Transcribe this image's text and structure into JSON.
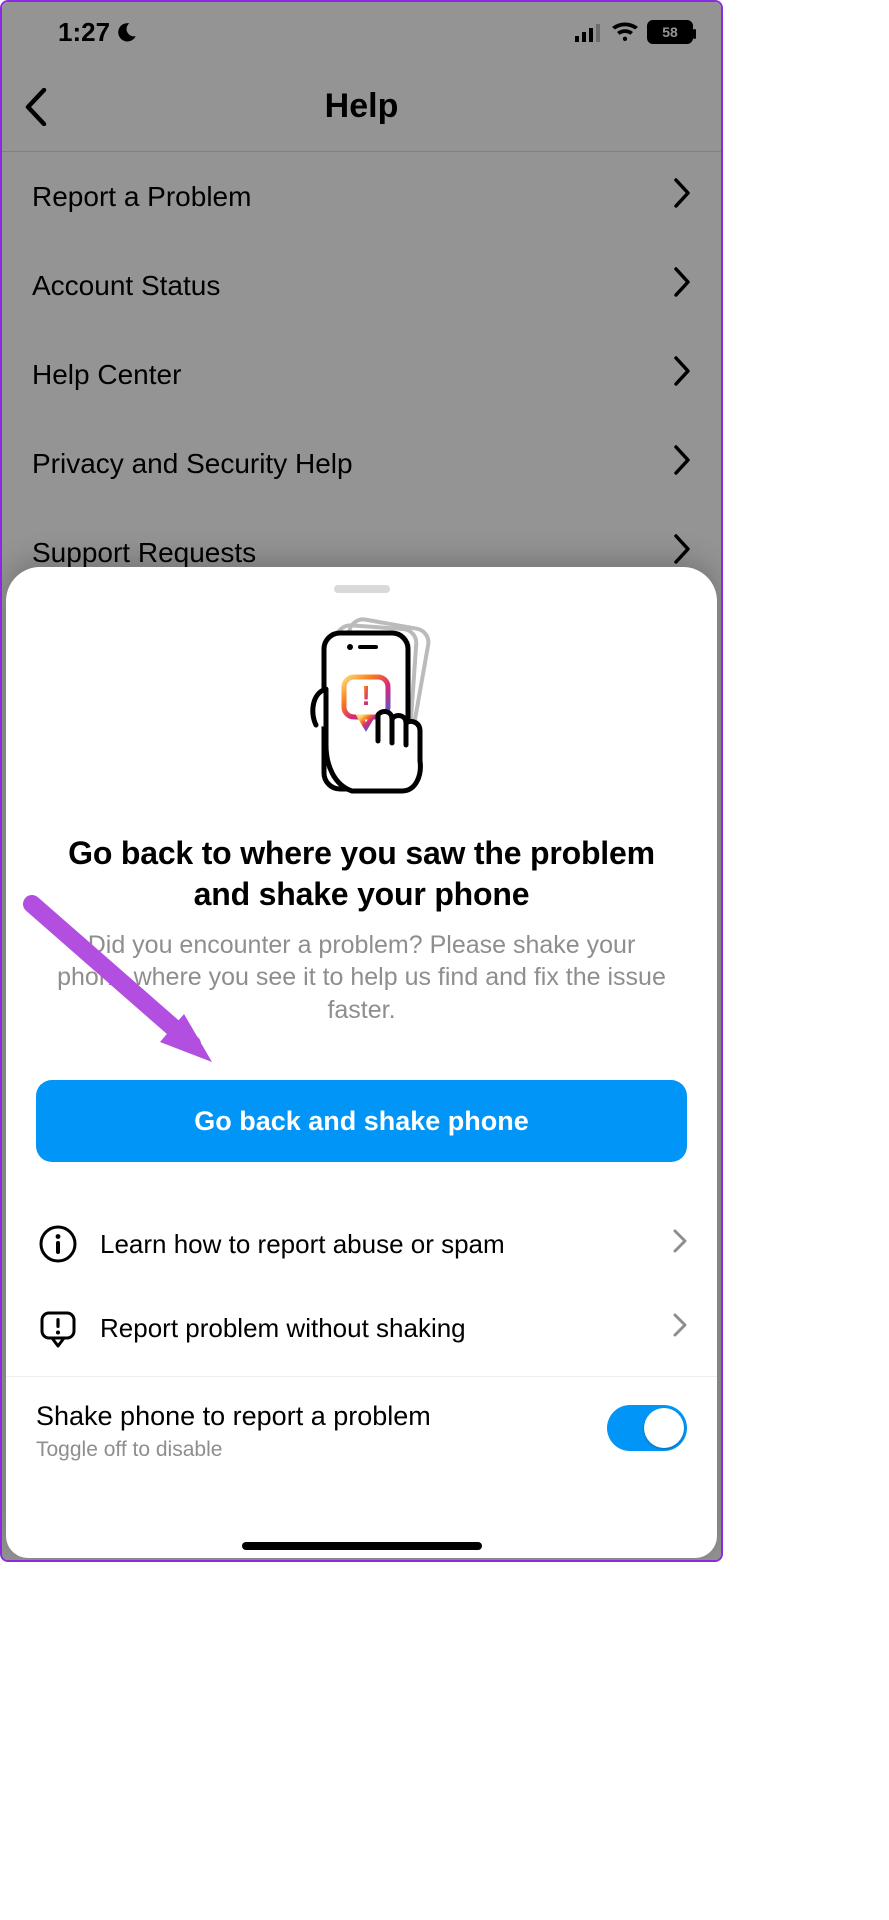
{
  "status": {
    "time": "1:27",
    "battery_label": "58"
  },
  "nav": {
    "title": "Help"
  },
  "menu": {
    "items": [
      {
        "label": "Report a Problem"
      },
      {
        "label": "Account Status"
      },
      {
        "label": "Help Center"
      },
      {
        "label": "Privacy and Security Help"
      },
      {
        "label": "Support Requests"
      }
    ]
  },
  "sheet": {
    "heading": "Go back to where you saw the problem and shake your phone",
    "subheading": "Did you encounter a problem? Please shake your phone where you see it to help us find and fix the issue faster.",
    "primary_button": "Go back and shake phone",
    "rows": [
      {
        "label": "Learn how to report abuse or spam",
        "icon": "info-icon"
      },
      {
        "label": "Report problem without shaking",
        "icon": "alert-bubble-icon"
      }
    ],
    "toggle": {
      "title": "Shake phone to report a problem",
      "sub": "Toggle off to disable",
      "on": true
    }
  }
}
